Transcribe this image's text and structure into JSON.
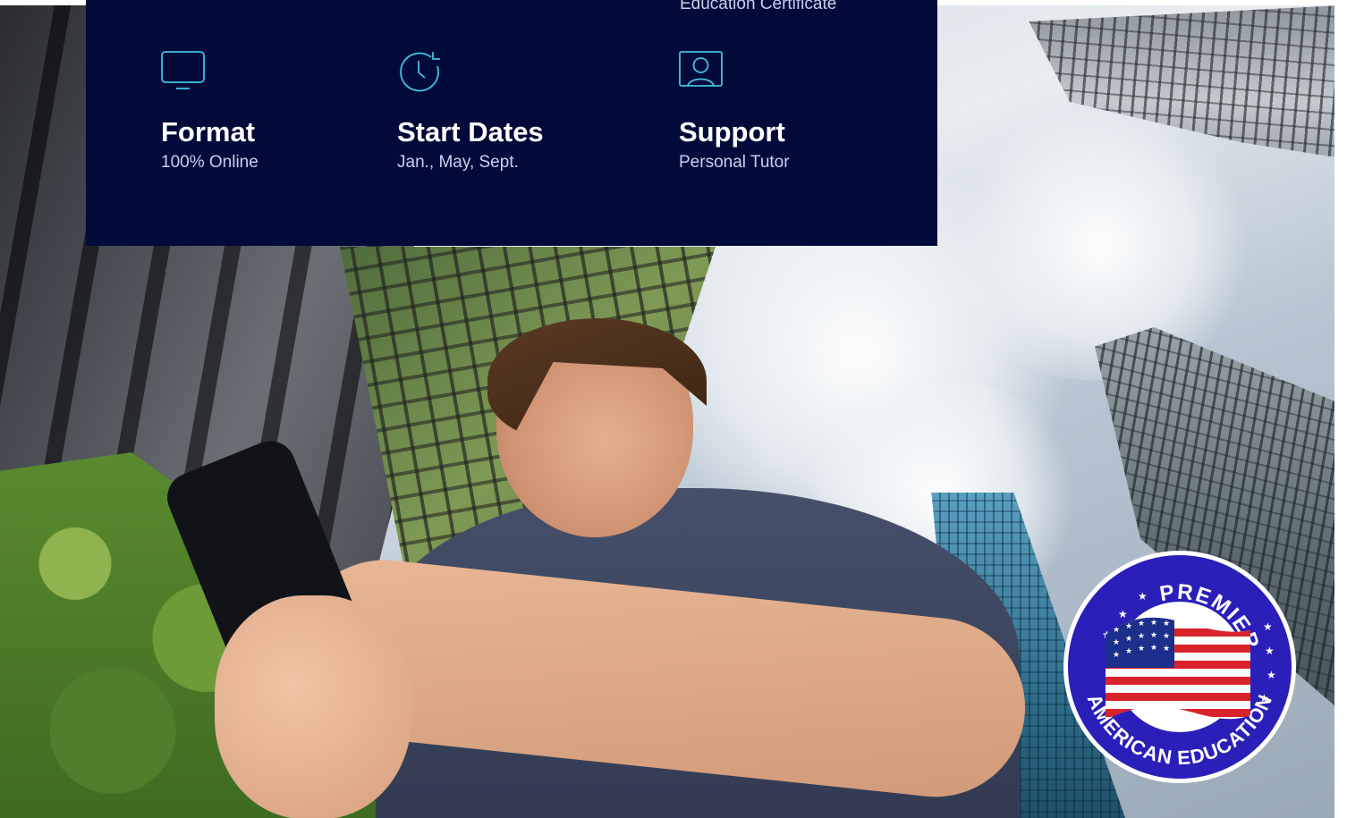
{
  "info_card": {
    "overflow_text": "Education Certificate",
    "items": [
      {
        "icon": "monitor-icon",
        "title": "Format",
        "value": "100% Online"
      },
      {
        "icon": "clock-refresh-icon",
        "title": "Start Dates",
        "value": "Jan., May, Sept."
      },
      {
        "icon": "user-portrait-icon",
        "title": "Support",
        "value": "Personal Tutor"
      }
    ],
    "colors": {
      "background": "#020a3a",
      "icon": "#3fc3e0",
      "title": "#ffffff",
      "value": "#c8d0ee"
    }
  },
  "badge": {
    "top_text": "PREMIER",
    "bottom_text": "AMERICAN EDUCATION",
    "icon": "us-flag-icon",
    "colors": {
      "ring": "#2a1fb8",
      "rim": "#ffffff"
    }
  }
}
